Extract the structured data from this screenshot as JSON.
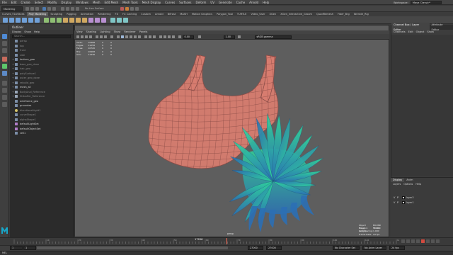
{
  "menubar": {
    "items": [
      "File",
      "Edit",
      "Create",
      "Select",
      "Modify",
      "Display",
      "Windows",
      "Mesh",
      "Edit Mesh",
      "Mesh Tools",
      "Mesh Display",
      "Curves",
      "Surfaces",
      "Deform",
      "UV",
      "Generate",
      "Cache",
      "Arnold",
      "Help"
    ],
    "workspace_label": "Workspace:",
    "workspace_value": "Maya Classic*"
  },
  "statusline": {
    "mode": "Modeling",
    "object_field": "No Live Surface"
  },
  "shelf_tabs": [
    "Curves / Surfaces",
    "Poly Modeling",
    "Sculpting",
    "Rigging",
    "Animation",
    "Rendering",
    "FX",
    "FX Caching",
    "Custom",
    "Arnold",
    "Bifrost",
    "MASH",
    "Motion Graphics",
    "Polygon_Tool",
    "TURTLE",
    "Video_User",
    "XGen",
    "XGen_Interactive_Groom",
    "QuadRemesh",
    "Fiber_Brg",
    "Wrinkle_Rig"
  ],
  "shelf_active": 1,
  "outliner": {
    "title": "Outliner",
    "menu": [
      "Display",
      "Show",
      "Help"
    ],
    "search_placeholder": "Search...",
    "items": [
      {
        "label": "persp",
        "icon": "camera-icon",
        "dim": true
      },
      {
        "label": "top",
        "icon": "camera-icon",
        "dim": true
      },
      {
        "label": "front",
        "icon": "camera-icon",
        "dim": true
      },
      {
        "label": "side",
        "icon": "camera-icon",
        "dim": true
      },
      {
        "label": "texture_geo",
        "icon": "mesh-icon",
        "dim": false
      },
      {
        "label": "base_geo_done",
        "icon": "mesh-icon",
        "dim": true
      },
      {
        "label": "hair_geo",
        "icon": "mesh-icon",
        "dim": true
      },
      {
        "label": "polySurface1",
        "icon": "mesh-icon",
        "dim": true
      },
      {
        "label": "outer_geo_done",
        "icon": "mesh-icon",
        "dim": true
      },
      {
        "label": "rebuild_geo",
        "icon": "mesh-icon",
        "dim": true
      },
      {
        "label": "mesh_all",
        "icon": "mesh-icon",
        "dim": false
      },
      {
        "label": "BodyAnal_Reference",
        "icon": "group-icon",
        "dim": true
      },
      {
        "label": "Shibaffer_Reference",
        "icon": "group-icon",
        "dim": true
      },
      {
        "label": "wireframe_geo",
        "icon": "mesh-icon",
        "dim": false
      },
      {
        "label": "groundes",
        "icon": "mesh-icon",
        "dim": false
      },
      {
        "label": "directionalLight1",
        "icon": "light-icon",
        "dim": true
      },
      {
        "label": "curveShape1",
        "icon": "curve-icon",
        "dim": true
      },
      {
        "label": "alphaShape1",
        "icon": "mesh-icon",
        "dim": true
      },
      {
        "label": "defaultLightSet",
        "icon": "set-icon",
        "dim": false
      },
      {
        "label": "defaultObjectSet",
        "icon": "set-icon",
        "dim": false
      },
      {
        "label": "cell1",
        "icon": "mesh-icon",
        "dim": false
      }
    ]
  },
  "viewport": {
    "menu": [
      "View",
      "Shading",
      "Lighting",
      "Show",
      "Renderer",
      "Panels"
    ],
    "fields": {
      "value_a": "0.00",
      "value_b": "1.00",
      "color_space": "sRGB gamma"
    },
    "hud_top": {
      "headers": [
        "",
        "",
        ""
      ],
      "rows": [
        {
          "k": "Verts:",
          "a": "10488",
          "b": "0",
          "c": "0"
        },
        {
          "k": "Edges:",
          "a": "21258",
          "b": "0",
          "c": "0"
        },
        {
          "k": "Faces:",
          "a": "10720",
          "b": "0",
          "c": "0"
        },
        {
          "k": "Tris:",
          "a": "20968",
          "b": "0",
          "c": "0"
        },
        {
          "k": "UVs:",
          "a": "11436",
          "b": "0",
          "c": "0"
        }
      ]
    },
    "hud_bottom": [
      {
        "k": "Object Polygon:",
        "v": "BOUND 50001"
      },
      {
        "k": "Focal Length:",
        "v": "35.000"
      },
      {
        "k": "Grid spacing:",
        "v": "1.000"
      },
      {
        "k": "Frame Rate:",
        "v": "24 fps"
      }
    ],
    "camera_label": "persp",
    "colors": {
      "shirt": "#d77c6f",
      "shirt_edge": "#8a4d48",
      "hair_light": "#2fd79a",
      "hair_dark": "#2b6fb5"
    }
  },
  "channel_box": {
    "tabs": [
      "Channel Box / Layer Editor",
      "Attribute Editor"
    ],
    "menu": [
      "Channels",
      "Edit",
      "Object",
      "Show"
    ]
  },
  "layer_editor": {
    "tabs": [
      "Display",
      "Anim"
    ],
    "menu": [
      "Layers",
      "Options",
      "Help"
    ],
    "layers": [
      {
        "v": "V",
        "p": "P",
        "name": "layer2",
        "swatch": "white"
      },
      {
        "v": "V",
        "p": "P",
        "name": "layer1",
        "swatch": "white"
      }
    ]
  },
  "timeline": {
    "current_frame": "17206",
    "tick_labels": [
      "10",
      "20",
      "30",
      "40",
      "50",
      "60",
      "70",
      "80",
      "90",
      "100",
      "110",
      "120"
    ],
    "range_start": "1",
    "range_inner_start": "1",
    "range_inner_end": "27000",
    "range_end": "27000",
    "character_set": "No Character Set",
    "anim_layer": "No Anim Layer",
    "fps": "24 fps"
  },
  "cmdline": {
    "lang": "MEL"
  }
}
